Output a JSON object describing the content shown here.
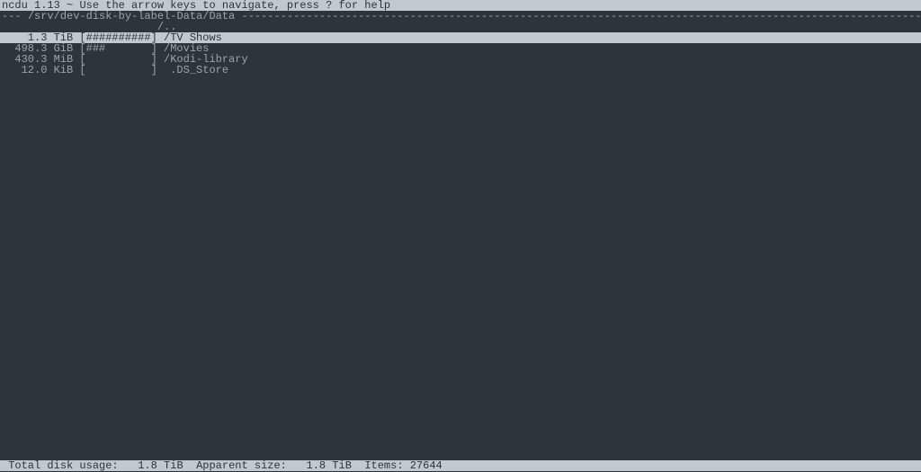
{
  "header": {
    "program": "ncdu",
    "version": "1.13",
    "help_hint": "Use the arrow keys to navigate, press ? for help"
  },
  "path": {
    "prefix": "---",
    "location": "/srv/dev-disk-by-label-Data/Data"
  },
  "parent_dir": "/..",
  "entries": [
    {
      "size": "1.3 TiB",
      "bar": "##########",
      "name": "/TV Shows",
      "selected": true
    },
    {
      "size": "498.3 GiB",
      "bar": "###       ",
      "name": "/Movies",
      "selected": false
    },
    {
      "size": "430.3 MiB",
      "bar": "          ",
      "name": "/Kodi-library",
      "selected": false
    },
    {
      "size": "12.0 KiB",
      "bar": "          ",
      "name": " .DS_Store",
      "selected": false
    }
  ],
  "footer": {
    "total_label": "Total disk usage:",
    "total_value": "1.8 TiB",
    "apparent_label": "Apparent size:",
    "apparent_value": "1.8 TiB",
    "items_label": "Items:",
    "items_value": "27644"
  }
}
